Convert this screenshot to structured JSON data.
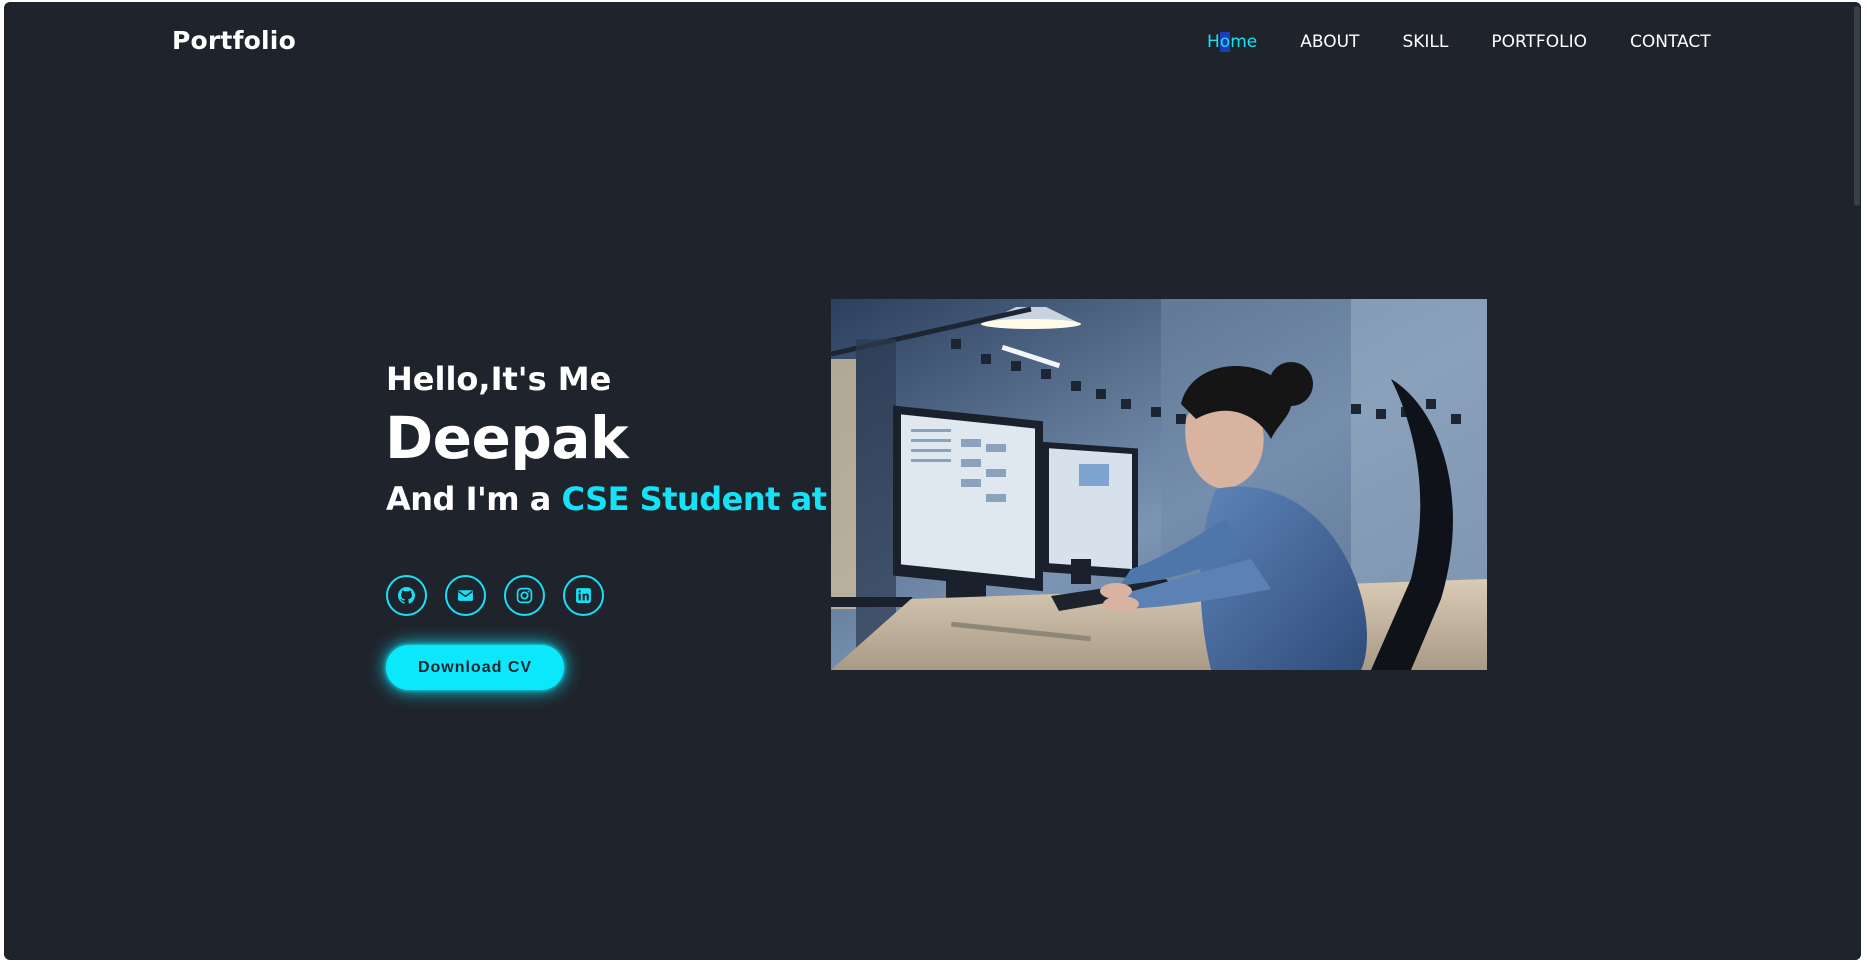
{
  "header": {
    "logo": "Portfolio",
    "nav": [
      {
        "label_sel_pre": "H",
        "label_sel": "o",
        "label_sel_post": "me",
        "active": true
      },
      {
        "label": "ABOUT"
      },
      {
        "label": "SKILL"
      },
      {
        "label": "PORTFOLIO"
      },
      {
        "label": "CONTACT"
      }
    ]
  },
  "hero": {
    "greeting": "Hello,It's Me",
    "name": "Deepak",
    "role_prefix": "And I'm a ",
    "role_typed": "CSE Student at III",
    "download_label": "Download CV",
    "socials": [
      "github-icon",
      "mail-icon",
      "instagram-icon",
      "linkedin-icon"
    ],
    "image_description_icon": "office-woman-at-computer-image"
  },
  "colors": {
    "background": "#1f232b",
    "accent": "#17e1f5",
    "text": "#ffffff"
  }
}
